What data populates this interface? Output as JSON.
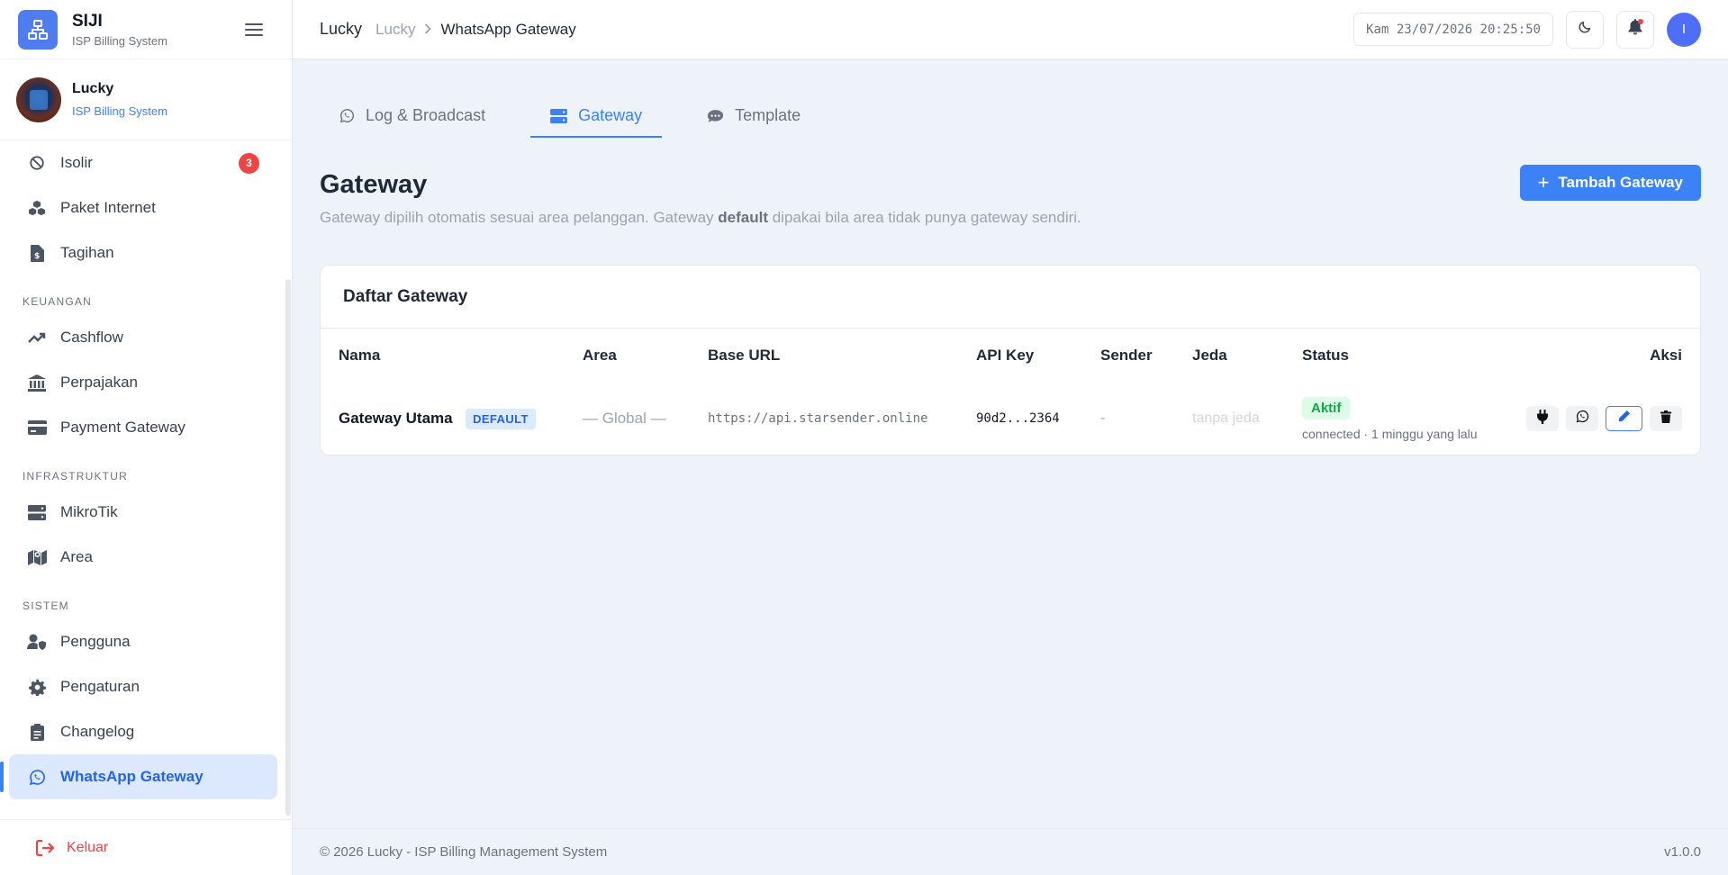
{
  "brand": {
    "name": "SIJI",
    "subtitle": "ISP Billing System",
    "logo_icon": "network-icon"
  },
  "profile": {
    "name": "Lucky",
    "subtitle": "ISP Billing System"
  },
  "sidebar": {
    "items_top": [
      {
        "label": "Isolir",
        "icon": "ban-icon",
        "badge": "3"
      },
      {
        "label": "Paket Internet",
        "icon": "cubes-icon"
      },
      {
        "label": "Tagihan",
        "icon": "invoice-icon"
      }
    ],
    "section_keuangan": "KEUANGAN",
    "items_keuangan": [
      {
        "label": "Cashflow",
        "icon": "trend-up-icon"
      },
      {
        "label": "Perpajakan",
        "icon": "bank-icon"
      },
      {
        "label": "Payment Gateway",
        "icon": "credit-card-icon"
      }
    ],
    "section_infra": "INFRASTRUKTUR",
    "items_infra": [
      {
        "label": "MikroTik",
        "icon": "server-icon"
      },
      {
        "label": "Area",
        "icon": "map-icon"
      }
    ],
    "section_sistem": "SISTEM",
    "items_sistem": [
      {
        "label": "Pengguna",
        "icon": "user-shield-icon"
      },
      {
        "label": "Pengaturan",
        "icon": "gear-icon"
      },
      {
        "label": "Changelog",
        "icon": "clipboard-icon"
      },
      {
        "label": "WhatsApp Gateway",
        "icon": "whatsapp-icon",
        "active": true
      }
    ],
    "logout": "Keluar"
  },
  "topbar": {
    "title": "Lucky",
    "breadcrumb_parent": "Lucky",
    "breadcrumb_current": "WhatsApp Gateway",
    "clock": "Kam 23/07/2026 20:25:50",
    "avatar_initial": "I"
  },
  "tabs": [
    {
      "label": "Log & Broadcast",
      "icon": "whatsapp-icon"
    },
    {
      "label": "Gateway",
      "icon": "server-icon",
      "active": true
    },
    {
      "label": "Template",
      "icon": "comments-icon"
    }
  ],
  "page": {
    "title": "Gateway",
    "desc_before": "Gateway dipilih otomatis sesuai area pelanggan. Gateway ",
    "desc_bold": "default",
    "desc_after": " dipakai bila area tidak punya gateway sendiri.",
    "add_button": "Tambah Gateway"
  },
  "table": {
    "card_title": "Daftar Gateway",
    "columns": [
      "Nama",
      "Area",
      "Base URL",
      "API Key",
      "Sender",
      "Jeda",
      "Status",
      "Aksi"
    ],
    "rows": [
      {
        "name": "Gateway Utama",
        "badge": "DEFAULT",
        "area": "— Global —",
        "base_url": "https://api.starsender.online",
        "api_key": "90d2...2364",
        "sender": "-",
        "jeda": "tanpa jeda",
        "status": "Aktif",
        "status_detail": "connected · 1 minggu yang lalu"
      }
    ]
  },
  "footer": {
    "copyright": "© 2026 Lucky - ISP Billing Management System",
    "version": "v1.0.0"
  },
  "colors": {
    "accent": "#3b82f6",
    "danger": "#ef4444",
    "success": "#16a34a"
  }
}
